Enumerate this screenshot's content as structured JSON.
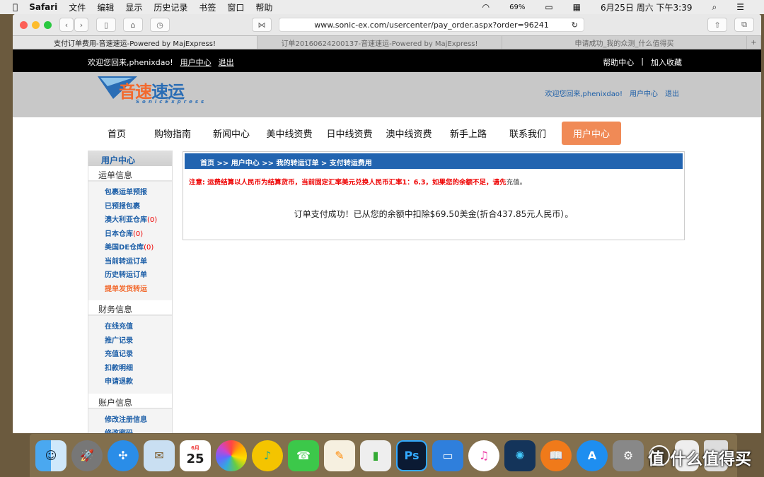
{
  "menubar": {
    "app": "Safari",
    "items": [
      "文件",
      "编辑",
      "显示",
      "历史记录",
      "书签",
      "窗口",
      "帮助"
    ],
    "battery": "69%",
    "datetime": "6月25日 周六 下午3:39"
  },
  "browser": {
    "url": "www.sonic-ex.com/usercenter/pay_order.aspx?order=96241",
    "tabs": [
      "支付订单费用-音速速运-Powered by MajExpress!",
      "订单20160624200137-音速速运-Powered by MajExpress!",
      "申请成功_我的众测_什么值得买"
    ]
  },
  "topbar": {
    "welcome": "欢迎您回来,phenixdao!",
    "user_center": "用户中心",
    "logout": "退出",
    "help": "帮助中心",
    "sep": "|",
    "bookmark": "加入收藏"
  },
  "header": {
    "logo_cn_a": "音速",
    "logo_cn_b": "速运",
    "logo_en": "SonicExpress",
    "welcome": "欢迎您回来,phenixdao!",
    "user_center": "用户中心",
    "logout": "退出"
  },
  "nav": [
    "首页",
    "购物指南",
    "新闻中心",
    "美中线资费",
    "日中线资费",
    "澳中线资费",
    "新手上路",
    "联系我们",
    "用户中心"
  ],
  "sidebar": {
    "title": "用户中心",
    "groups": [
      {
        "label": "运单信息",
        "items": [
          "包裹运单预报",
          "已预报包裹",
          "澳大利亚仓库",
          "日本仓库",
          "美国DE仓库",
          "当前转运订单",
          "历史转运订单",
          "提单发货转运"
        ]
      },
      {
        "label": "财务信息",
        "items": [
          "在线充值",
          "推广记录",
          "充值记录",
          "扣款明细",
          "申请退款"
        ]
      },
      {
        "label": "账户信息",
        "items": [
          "修改注册信息",
          "修改密码"
        ]
      }
    ],
    "count": "(0)"
  },
  "main": {
    "breadcrumb": "首页 >> 用户中心 >> 我的转运订单 > 支付转运费用",
    "notice": "注意: 运费结算以人民币为结算货币，当前固定汇率美元兑换人民币汇率1：6.3，如果您的余额不足，请先",
    "notice_link": "充值。",
    "message": "订单支付成功！已从您的余额中扣除$69.50美金(折合437.85元人民币）。"
  },
  "dock": {
    "apps": [
      "finder",
      "launchpad",
      "safari",
      "mail",
      "calendar",
      "photos",
      "qq-music",
      "facetime",
      "pages",
      "numbers",
      "photoshop",
      "keynote",
      "itunes",
      "app",
      "ibooks",
      "app-store",
      "system-preferences",
      "什么值得买"
    ],
    "calendar_day": "25",
    "calendar_month": "6月",
    "ps": "Ps",
    "smzdm": "值 什么值得买"
  },
  "colors": {
    "accent": "#2264b0",
    "nav_active": "#f08a56",
    "notice": "#ee0000"
  }
}
